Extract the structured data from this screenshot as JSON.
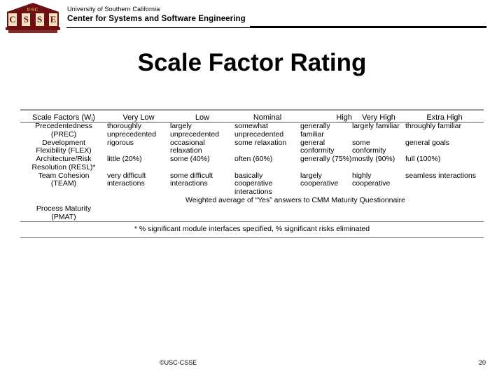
{
  "branding": {
    "university": "University of Southern California",
    "center": "Center for Systems and Software Engineering",
    "logo_top_text": "USC",
    "logo_letters": [
      "C",
      "S",
      "S",
      "E"
    ],
    "brand_color": "#6d0f14"
  },
  "slide": {
    "title": "Scale Factor Rating",
    "page_number": "20",
    "copyright": "©USC-CSSE"
  },
  "table": {
    "headers": [
      "Scale Factors (Wi)",
      "Very Low",
      "Low",
      "Nominal",
      "High",
      "Very High",
      "Extra High"
    ],
    "header_first_label": "Scale Factors (W",
    "header_first_sub": "i",
    "header_first_tail": ")",
    "rows": [
      {
        "factor_line1": "Precedentedness",
        "factor_line2": "(PREC)",
        "values": [
          "thoroughly unprecedented",
          "largely unprecedented",
          "somewhat unprecedented",
          "generally familiar",
          "largely familiar",
          "throughly familiar"
        ]
      },
      {
        "factor_line1": "Development",
        "factor_line2": "Flexibility (FLEX)",
        "values": [
          "rigorous",
          "occasional relaxation",
          "some relaxation",
          "general conformity",
          "some conformity",
          "general goals"
        ]
      },
      {
        "factor_line1": "Architecture/Risk",
        "factor_line2": "Resolution (RESL)*",
        "values": [
          "little (20%)",
          "some (40%)",
          "often (60%)",
          "generally (75%)",
          "mostly (90%)",
          "full (100%)"
        ]
      },
      {
        "factor_line1": "Team Cohesion",
        "factor_line2": "(TEAM)",
        "values": [
          "very difficult interactions",
          "some difficult interactions",
          "basically cooperative interactions",
          "largely cooperative",
          "highly cooperative",
          "seamless interactions"
        ]
      }
    ],
    "pmat_row": {
      "factor_line1": "Process Maturity",
      "factor_line2": "(PMAT)",
      "span_text": "Weighted average of “Yes” answers to CMM Maturity Questionnaire"
    },
    "footnote": "* % significant module interfaces specified, % significant risks eliminated"
  }
}
